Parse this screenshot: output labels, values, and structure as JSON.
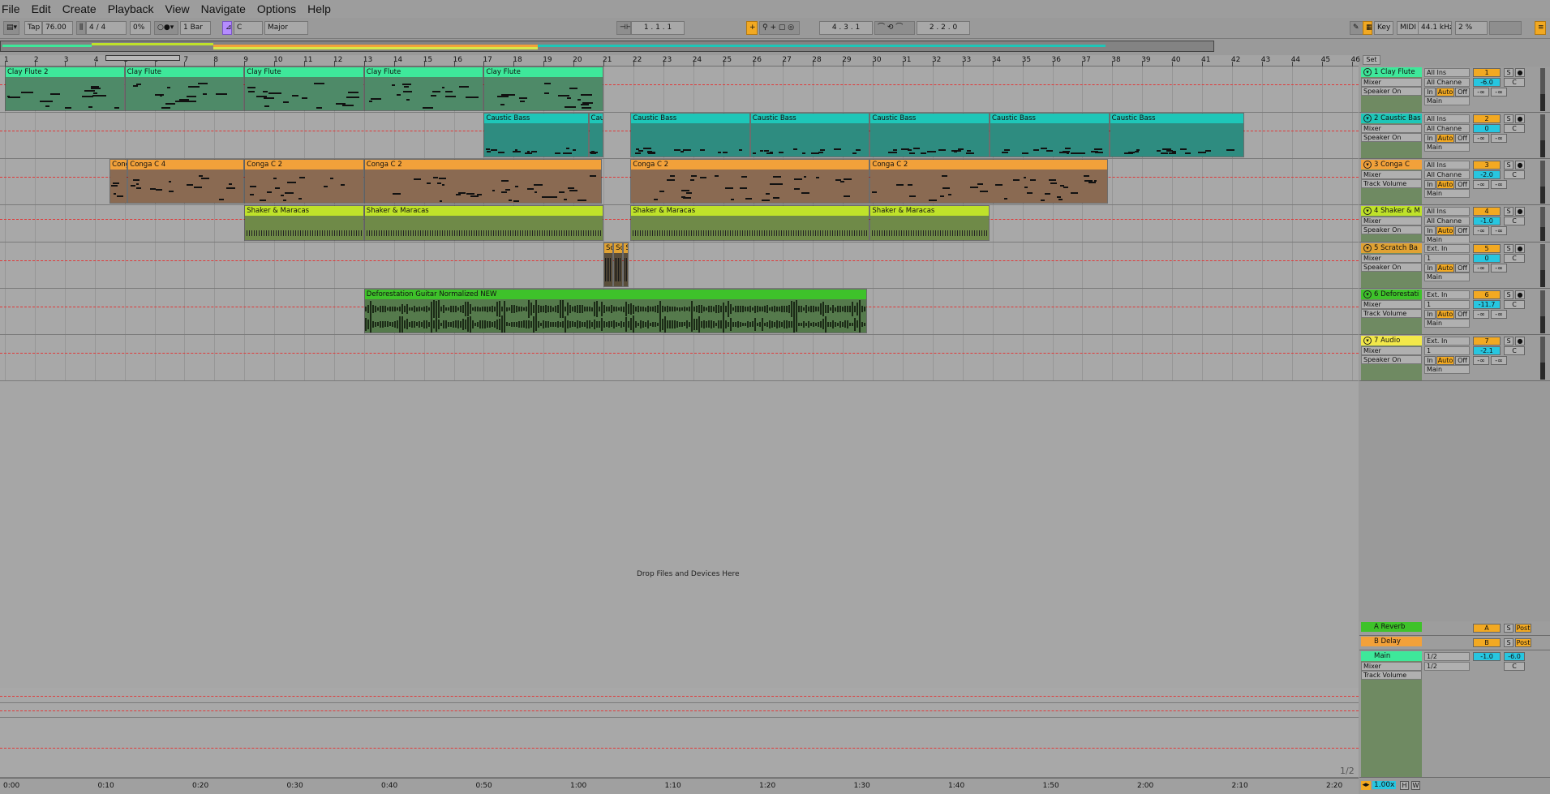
{
  "menu": [
    "File",
    "Edit",
    "Create",
    "Playback",
    "View",
    "Navigate",
    "Options",
    "Help"
  ],
  "control_bar": {
    "tap_label": "Tap",
    "tempo": "76.00",
    "time_signature": "4 / 4",
    "groove": "0%",
    "quantization": "1 Bar",
    "key_root": "C",
    "scale": "Major",
    "position": "1 .  1 .  1",
    "loop_start": "4 .  3 .  1",
    "loop_length": "2 .  2 .  0",
    "key_label": "Key",
    "midi_label": "MIDI",
    "sample_rate": "44.1 kHz",
    "cpu": "2 %"
  },
  "bar_numbers": [
    "1",
    "2",
    "3",
    "4",
    "5",
    "6",
    "7",
    "8",
    "9",
    "10",
    "11",
    "12",
    "13",
    "14",
    "15",
    "16",
    "17",
    "18",
    "19",
    "20",
    "21",
    "22",
    "23",
    "24",
    "25",
    "26",
    "27",
    "28",
    "29",
    "30",
    "31",
    "32",
    "33",
    "34",
    "35",
    "36",
    "37",
    "38",
    "39",
    "40",
    "41",
    "42",
    "43",
    "44",
    "45",
    "46"
  ],
  "time_labels": [
    "0:00",
    "0:10",
    "0:20",
    "0:30",
    "0:40",
    "0:50",
    "1:00",
    "1:10",
    "1:20",
    "1:30",
    "1:40",
    "1:50",
    "2:00",
    "2:10",
    "2:20"
  ],
  "drop_message": "Drop Files and Devices Here",
  "page_indicator": "1/2",
  "set_label": "Set",
  "zoom": "1.00x",
  "colors": {
    "flute": "#3ee89a",
    "flute_body": "#4e8a68",
    "bass": "#1ec6b8",
    "bass_body": "#2e8c80",
    "conga": "#f2a13a",
    "conga_body": "#8a6a52",
    "shaker": "#bfe22a",
    "shaker_body": "#6f8a48",
    "scratch": "#e0a233",
    "guitar": "#3ec22a",
    "guitar_body": "#557a4c",
    "audio": "#f2e84a"
  },
  "tracks": [
    {
      "name": "1 Clay Flute",
      "color": "#3ee89a",
      "input": "All Ins",
      "channel": "All Channe",
      "mixer": "Mixer",
      "monitor": "Speaker On",
      "output": "Main",
      "number": "1",
      "volume": "-6.0",
      "pan": "C",
      "send_a": "-∞",
      "send_b": "-∞",
      "clips": [
        {
          "name": "Clay Flute 2",
          "start": 1,
          "end": 5
        },
        {
          "name": "Clay Flute",
          "start": 5,
          "end": 9
        },
        {
          "name": "Clay Flute",
          "start": 9,
          "end": 13
        },
        {
          "name": "Clay Flute",
          "start": 13,
          "end": 17
        },
        {
          "name": "Clay Flute",
          "start": 17,
          "end": 21
        }
      ]
    },
    {
      "name": "2 Caustic Bas",
      "color": "#1ec6b8",
      "input": "All Ins",
      "channel": "All Channe",
      "mixer": "Mixer",
      "monitor": "Speaker On",
      "output": "Main",
      "number": "2",
      "volume": "0",
      "pan": "C",
      "send_a": "-∞",
      "send_b": "-∞",
      "clips": [
        {
          "name": "Caustic Bass",
          "start": 17,
          "end": 20.5
        },
        {
          "name": "Cau",
          "start": 20.5,
          "end": 21
        },
        {
          "name": "Caustic Bass",
          "start": 21.9,
          "end": 25.9
        },
        {
          "name": "Caustic Bass",
          "start": 25.9,
          "end": 29.9
        },
        {
          "name": "Caustic Bass",
          "start": 29.9,
          "end": 33.9
        },
        {
          "name": "Caustic Bass",
          "start": 33.9,
          "end": 37.9
        },
        {
          "name": "Caustic Bass",
          "start": 37.9,
          "end": 42.4
        }
      ]
    },
    {
      "name": "3 Conga C",
      "color": "#f2a13a",
      "input": "All Ins",
      "channel": "All Channe",
      "mixer": "Mixer",
      "monitor": "Track Volume",
      "output": "Main",
      "number": "3",
      "volume": "-2.0",
      "pan": "C",
      "send_a": "-∞",
      "send_b": "-∞",
      "clips": [
        {
          "name": "Conga",
          "start": 4.5,
          "end": 5.1
        },
        {
          "name": "Conga C 4",
          "start": 5.1,
          "end": 9
        },
        {
          "name": "Conga C 2",
          "start": 9,
          "end": 13
        },
        {
          "name": "Conga C 2",
          "start": 13,
          "end": 20.95
        },
        {
          "name": "Conga C 2",
          "start": 21.9,
          "end": 29.9
        },
        {
          "name": "Conga C 2",
          "start": 29.9,
          "end": 37.85
        }
      ]
    },
    {
      "name": "4 Shaker & M",
      "color": "#bfe22a",
      "input": "All Ins",
      "channel": "All Channe",
      "mixer": "Mixer",
      "monitor": "Speaker On",
      "output": "Main",
      "number": "4",
      "volume": "-1.0",
      "pan": "C",
      "send_a": "-∞",
      "send_b": "-∞",
      "clips": [
        {
          "name": "Shaker & Maracas",
          "start": 9,
          "end": 13
        },
        {
          "name": "Shaker & Maracas",
          "start": 13,
          "end": 21
        },
        {
          "name": "Shaker & Maracas",
          "start": 21.9,
          "end": 29.9
        },
        {
          "name": "Shaker & Maracas",
          "start": 29.9,
          "end": 33.9
        }
      ]
    },
    {
      "name": "5 Scratch Ba",
      "color": "#e0a233",
      "input": "Ext. In",
      "channel": "1",
      "mixer": "Mixer",
      "monitor": "Speaker On",
      "output": "Main",
      "number": "5",
      "volume": "0",
      "pan": "C",
      "send_a": "-∞",
      "send_b": "-∞",
      "clips": [
        {
          "name": "Sc",
          "start": 21,
          "end": 21.33
        },
        {
          "name": "Sc",
          "start": 21.33,
          "end": 21.66
        },
        {
          "name": "S",
          "start": 21.66,
          "end": 21.85
        }
      ]
    },
    {
      "name": "6 Deforestati",
      "color": "#3ec22a",
      "input": "Ext. In",
      "channel": "1",
      "mixer": "Mixer",
      "monitor": "Track Volume",
      "output": "Main",
      "number": "6",
      "volume": "-11.7",
      "pan": "C",
      "send_a": "-∞",
      "send_b": "-∞",
      "clips": [
        {
          "name": "Deforestation Guitar Normalized NEW",
          "start": 13,
          "end": 29.8
        }
      ]
    },
    {
      "name": "7 Audio",
      "color": "#f2e84a",
      "input": "Ext. In",
      "channel": "1",
      "mixer": "Mixer",
      "monitor": "Speaker On",
      "output": "Main",
      "number": "7",
      "volume": "-2.1",
      "pan": "C",
      "send_a": "-∞",
      "send_b": "-∞",
      "clips": []
    }
  ],
  "returns": [
    {
      "name": "A Reverb",
      "color": "#3ec22a",
      "letter": "A",
      "post": "Post"
    },
    {
      "name": "B Delay",
      "color": "#f2a13a",
      "letter": "B",
      "post": "Post"
    }
  ],
  "main": {
    "name": "Main",
    "color": "#3ee89a",
    "input1": "1/2",
    "input2": "1/2",
    "mixer": "Mixer",
    "monitor": "Track Volume",
    "volume": "-1.0",
    "vol2": "-6.0",
    "pan": "C"
  }
}
